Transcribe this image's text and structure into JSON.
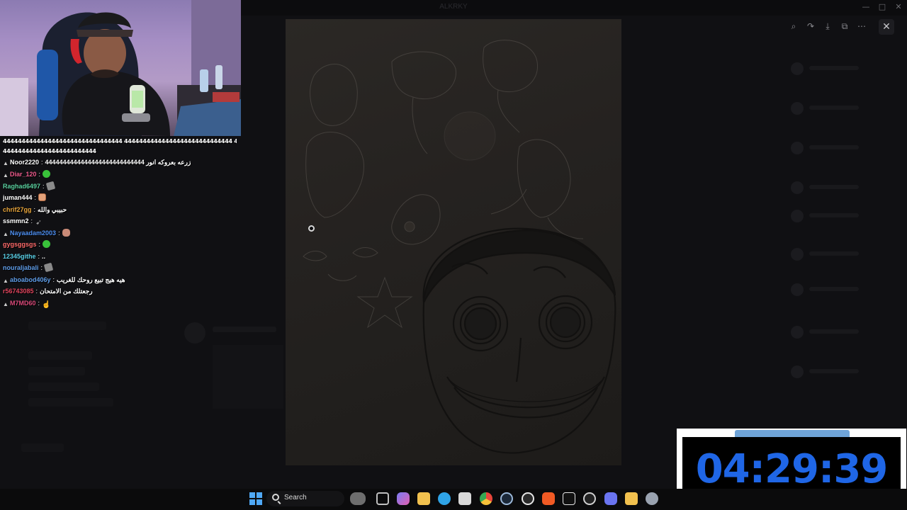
{
  "window": {
    "title": "ALKRKY",
    "minimize_glyph": "—",
    "maximize_glyph": "□",
    "close_glyph": "✕"
  },
  "viewer": {
    "close_glyph": "✕",
    "tools": [
      {
        "icon": "zoom-icon",
        "glyph": "⌕"
      },
      {
        "icon": "redo-icon",
        "glyph": "↷"
      },
      {
        "icon": "download-icon",
        "glyph": "⤓"
      },
      {
        "icon": "open-external-icon",
        "glyph": "⧉"
      },
      {
        "icon": "more-icon",
        "glyph": "⋯"
      }
    ]
  },
  "chat": {
    "spam_lines": [
      "44444444444444444444444444444444 44444444444444444444444444444 4444444444444444444444444444444",
      "4444444444444444444444444"
    ],
    "messages": [
      {
        "user": "Noor2220",
        "color": "#ffffff",
        "text": "زرعه بعروكه انور 4444444444444444444444444444",
        "emote": ""
      },
      {
        "user": "Diar_120",
        "color": "#f05c8e",
        "text": "",
        "emote": "green"
      },
      {
        "user": "Raghad6497",
        "color": "#5bd1a0",
        "text": "",
        "emote": "gray"
      },
      {
        "user": "juman444",
        "color": "#ffffff",
        "text": "",
        "emote": "face"
      },
      {
        "user": "chrif27gg",
        "color": "#e8a53b",
        "text": "حبيبي والله",
        "emote": ""
      },
      {
        "user": "ssmmn2",
        "color": "#ffffff",
        "text": "",
        "emote": "wolf"
      },
      {
        "user": "Nayaadam2003",
        "color": "#4d8ef0",
        "text": "",
        "emote": "hand"
      },
      {
        "user": "gygsggsgs",
        "color": "#ff6b6b",
        "text": "",
        "emote": "green"
      },
      {
        "user": "12345githe",
        "color": "#5bd1e8",
        "text": "..",
        "emote": ""
      },
      {
        "user": "nouraljabali",
        "color": "#5f9de8",
        "text": "",
        "emote": "gray"
      },
      {
        "user": "aboabod406y",
        "color": "#5f9de8",
        "text": "هيه هيج تبيع روحك للغريب",
        "emote": ""
      },
      {
        "user": "r56743085",
        "color": "#e0455d",
        "text": "رجعتلك من الامتحان",
        "emote": ""
      },
      {
        "user": "M7MD60",
        "color": "#d94a7a",
        "text": "",
        "emote": "arm"
      }
    ]
  },
  "timer": {
    "value": "04:29:39",
    "note": "..."
  },
  "taskbar": {
    "search_label": "Search",
    "apps": [
      {
        "icon": "widgets-icon",
        "color": "#d9d9d9"
      },
      {
        "icon": "task-view-icon",
        "color": "#bfbfbf"
      },
      {
        "icon": "copilot-icon",
        "color": "#7a7cf5"
      },
      {
        "icon": "file-explorer-icon",
        "color": "#f2c14e"
      },
      {
        "icon": "edge-icon",
        "color": "#2fa4e7"
      },
      {
        "icon": "store-icon",
        "color": "#d8d8d8"
      },
      {
        "icon": "chrome-icon",
        "color": "#e9453a"
      },
      {
        "icon": "steam-icon",
        "color": "#9bb8d9"
      },
      {
        "icon": "obs-icon",
        "color": "#e6e6e6"
      },
      {
        "icon": "brave-icon",
        "color": "#f15a24"
      },
      {
        "icon": "capcut-icon",
        "color": "#e6e6e6"
      },
      {
        "icon": "streamlabs-icon",
        "color": "#cfcfcf"
      },
      {
        "icon": "discord-icon",
        "color": "#6a74f0"
      },
      {
        "icon": "app-yellow-icon",
        "color": "#f2c14e"
      },
      {
        "icon": "settings-icon",
        "color": "#9aa3b0"
      }
    ]
  }
}
